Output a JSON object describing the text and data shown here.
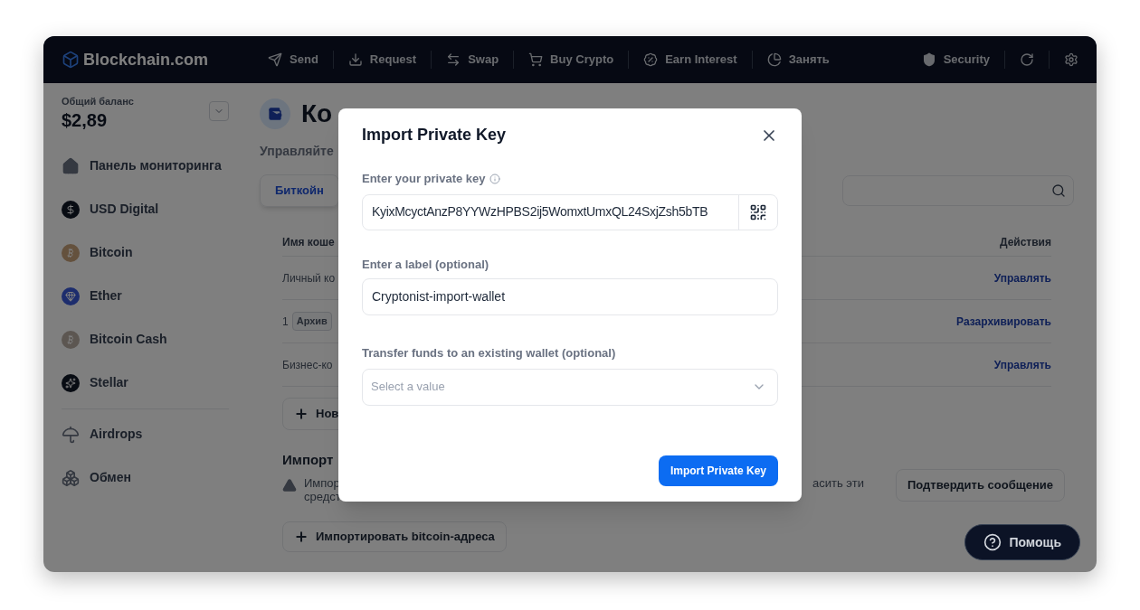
{
  "header": {
    "logo": "Blockchain.com",
    "nav": [
      {
        "label": "Send",
        "kind": "send"
      },
      {
        "label": "Request",
        "kind": "request"
      },
      {
        "label": "Swap",
        "kind": "swap"
      },
      {
        "label": "Buy Crypto",
        "kind": "cart"
      },
      {
        "label": "Earn Interest",
        "kind": "percent"
      },
      {
        "label": "Занять",
        "kind": "pie"
      }
    ],
    "security": "Security"
  },
  "sidebar": {
    "balance_label": "Общий баланс",
    "balance": "$2,89",
    "coins": [
      {
        "label": "Панель мониторинга",
        "kind": "home"
      },
      {
        "label": "USD Digital",
        "kind": "usd"
      },
      {
        "label": "Bitcoin",
        "kind": "btc"
      },
      {
        "label": "Ether",
        "kind": "eth"
      },
      {
        "label": "Bitcoin Cash",
        "kind": "bch"
      },
      {
        "label": "Stellar",
        "kind": "xlm"
      }
    ],
    "extras": [
      {
        "label": "Airdrops",
        "kind": "airdrop"
      },
      {
        "label": "Обмен",
        "kind": "exchange"
      }
    ]
  },
  "page": {
    "title": "Ко",
    "subtitle": "Управляйте",
    "tabs": [
      {
        "label": "Биткойн",
        "selected": true
      }
    ],
    "table": {
      "columns": [
        "Имя коше",
        "Действия"
      ],
      "rows": [
        {
          "name": "Личный ко",
          "action": "Управлять"
        },
        {
          "index": "1",
          "badge": "Архив",
          "action": "Разархивировать"
        },
        {
          "name": "Бизнес-ко",
          "action": "Управлять"
        }
      ]
    },
    "new_button": "Нов",
    "import": {
      "heading": "Импорт",
      "warning": "Импор средст",
      "warning_tail": "асить эти",
      "confirm_button": "Подтвердить сообщение",
      "import_button": "Импортировать bitcoin-адреса"
    },
    "help_button": "Помощь"
  },
  "modal": {
    "title": "Import Private Key",
    "key_label": "Enter your private key",
    "key_value": "KyixMcyctAnzP8YYWzHPBS2ij5WomxtUmxQL24SxjZsh5bTB",
    "label_label": "Enter a label (optional)",
    "label_value": "Cryptonist-import-wallet",
    "transfer_label": "Transfer funds to an existing wallet (optional)",
    "transfer_placeholder": "Select a value",
    "submit": "Import Private Key"
  }
}
